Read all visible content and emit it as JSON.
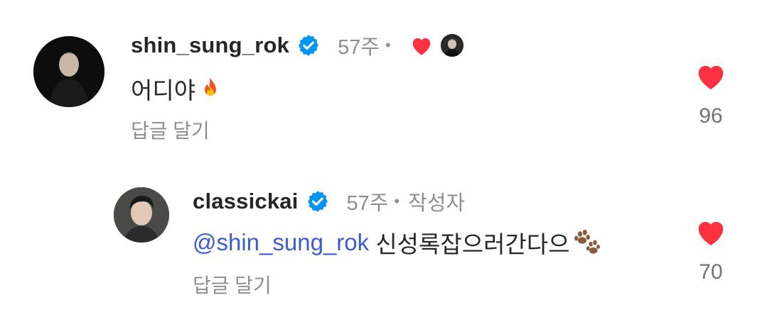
{
  "comments": [
    {
      "username": "shin_sung_rok",
      "time": "57주",
      "dot": "•",
      "text": "어디야",
      "emoji_icon": "fire-icon",
      "reply_label": "답글 달기",
      "like_count": "96",
      "verified": true,
      "liked_by_author": true
    },
    {
      "username": "classickai",
      "time": "57주",
      "dot": "•",
      "author_tag": "작성자",
      "mention": "@shin_sung_rok",
      "text": " 신성록잡으러간다으",
      "emoji_icon": "paw-prints-icon",
      "reply_label": "답글 달기",
      "like_count": "70",
      "verified": true
    }
  ],
  "colors": {
    "heart": "#ff3040",
    "verified": "#0095f6",
    "mention": "#3b5bdb",
    "muted": "#8e8e8e"
  }
}
